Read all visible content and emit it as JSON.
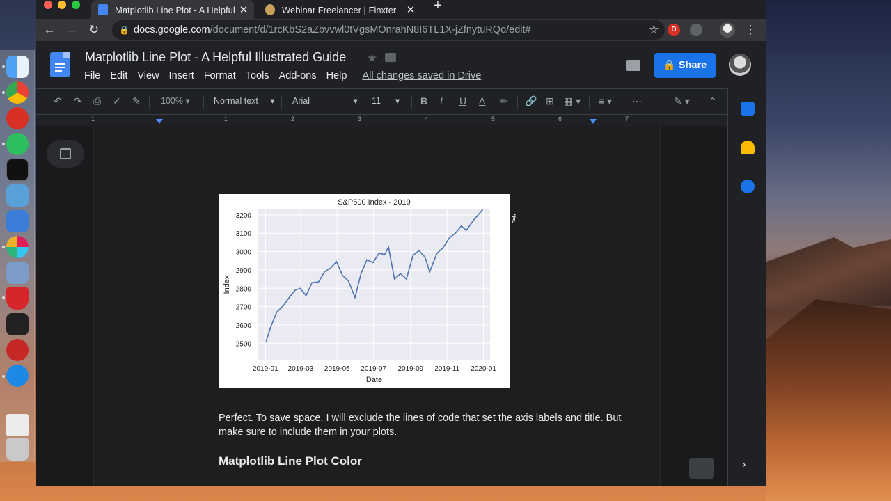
{
  "browser": {
    "tabs": [
      {
        "title": "Matplotlib Line Plot - A Helpful I",
        "close": "✕",
        "active": true
      },
      {
        "title": "Webinar Freelancer | Finxter",
        "close": "✕",
        "active": false
      }
    ],
    "new_tab": "+",
    "url_host": "docs.google.com",
    "url_path": "/document/d/1rcKbS2aZbvvwl0tVgsMOnrahN8I6TL1X-jZfnytuRQo/edit#",
    "extension_badge": "D"
  },
  "docs": {
    "title": "Matplotlib Line Plot - A Helpful Illustrated Guide",
    "menu": [
      "File",
      "Edit",
      "View",
      "Insert",
      "Format",
      "Tools",
      "Add-ons",
      "Help"
    ],
    "saved_status": "All changes saved in Drive",
    "share_label": "Share",
    "toolbar": {
      "zoom": "100%",
      "style": "Normal text",
      "font": "Arial",
      "font_size": "11"
    },
    "ruler_numbers": [
      "1",
      "1",
      "2",
      "3",
      "4",
      "5",
      "6",
      "7"
    ],
    "paragraph": "Perfect. To save space, I will exclude the lines of code that set the axis labels and title. But make sure to include them in your plots.",
    "heading": "Matplotlib Line Plot Color"
  },
  "chart_data": {
    "type": "line",
    "title": "S&P500 Index - 2019",
    "xlabel": "Date",
    "ylabel": "Index",
    "x_ticks": [
      "2019-01",
      "2019-03",
      "2019-05",
      "2019-07",
      "2019-09",
      "2019-11",
      "2020-01"
    ],
    "y_ticks": [
      2500,
      2600,
      2700,
      2800,
      2900,
      3000,
      3100,
      3200
    ],
    "ylim": [
      2410,
      3230
    ],
    "grid": true,
    "line_color": "#4c72b0",
    "background": "#eaeaf2",
    "series": [
      {
        "x": [
          "2019-01-02",
          "2019-01-10",
          "2019-01-20",
          "2019-01-31",
          "2019-02-10",
          "2019-02-20",
          "2019-02-28",
          "2019-03-10",
          "2019-03-20",
          "2019-03-31",
          "2019-04-10",
          "2019-04-20",
          "2019-04-30",
          "2019-05-10",
          "2019-05-20",
          "2019-05-31",
          "2019-06-10",
          "2019-06-20",
          "2019-06-30",
          "2019-07-10",
          "2019-07-20",
          "2019-07-26",
          "2019-08-05",
          "2019-08-15",
          "2019-08-25",
          "2019-09-05",
          "2019-09-15",
          "2019-09-25",
          "2019-10-03",
          "2019-10-15",
          "2019-10-25",
          "2019-11-05",
          "2019-11-15",
          "2019-11-25",
          "2019-12-03",
          "2019-12-15",
          "2019-12-31"
        ],
        "values": [
          2510,
          2590,
          2670,
          2705,
          2750,
          2790,
          2800,
          2760,
          2830,
          2835,
          2890,
          2910,
          2945,
          2870,
          2840,
          2750,
          2880,
          2955,
          2940,
          2990,
          2985,
          3025,
          2850,
          2880,
          2850,
          2980,
          3005,
          2970,
          2890,
          2990,
          3020,
          3075,
          3100,
          3140,
          3115,
          3170,
          3230
        ]
      }
    ]
  }
}
